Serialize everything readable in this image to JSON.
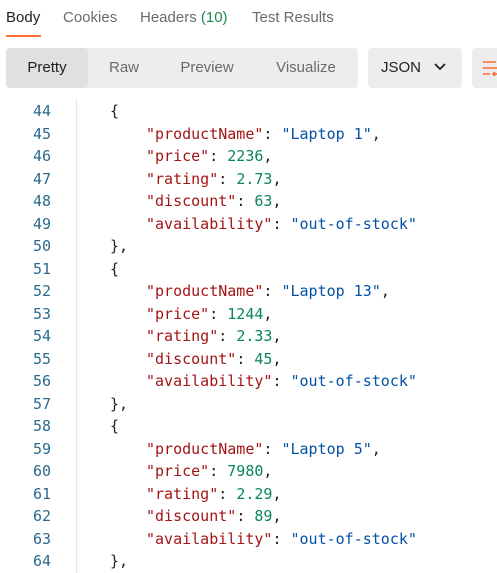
{
  "response_tabs": [
    {
      "label": "Body",
      "active": true
    },
    {
      "label": "Cookies",
      "active": false
    },
    {
      "label": "Headers",
      "count": "(10)",
      "active": false
    },
    {
      "label": "Test Results",
      "active": false
    }
  ],
  "view_modes": [
    "Pretty",
    "Raw",
    "Preview",
    "Visualize"
  ],
  "active_view": "Pretty",
  "format": "JSON",
  "colors": {
    "accent": "#ff6c37",
    "count_green": "#1e8a4c",
    "key": "#a31515",
    "string": "#0451a5",
    "number": "#098658",
    "line_number": "#2b6a8e"
  },
  "code": {
    "first_line": 44,
    "products": [
      {
        "productName": "Laptop 1",
        "price": 2236,
        "rating": 2.73,
        "discount": 63,
        "availability": "out-of-stock"
      },
      {
        "productName": "Laptop 13",
        "price": 1244,
        "rating": 2.33,
        "discount": 45,
        "availability": "out-of-stock"
      },
      {
        "productName": "Laptop 5",
        "price": 7980,
        "rating": 2.29,
        "discount": 89,
        "availability": "out-of-stock"
      }
    ]
  }
}
